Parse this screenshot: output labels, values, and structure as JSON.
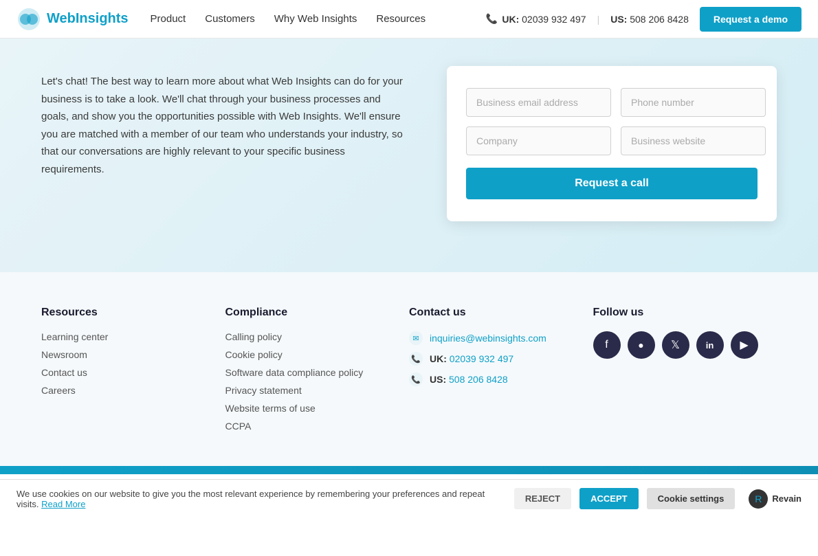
{
  "navbar": {
    "logo_text_main": "Web",
    "logo_text_highlight": "Insights",
    "links": [
      {
        "id": "product",
        "label": "Product"
      },
      {
        "id": "customers",
        "label": "Customers"
      },
      {
        "id": "why",
        "label": "Why Web Insights"
      },
      {
        "id": "resources",
        "label": "Resources"
      }
    ],
    "phone_uk_label": "UK:",
    "phone_uk": "02039 932 497",
    "phone_us_label": "US:",
    "phone_us": "508 206 8428",
    "cta_label": "Request a demo"
  },
  "hero": {
    "description": "Let's chat! The best way to learn more about what Web Insights can do for your business is to take a look. We'll chat through your business processes and goals, and show you the opportunities possible with Web Insights. We'll ensure you are matched with a member of our team who understands your industry, so that our conversations are highly relevant to your specific business requirements."
  },
  "form": {
    "fields": [
      {
        "id": "business-email",
        "placeholder": "Business email address"
      },
      {
        "id": "phone-number",
        "placeholder": "Phone number"
      },
      {
        "id": "company",
        "placeholder": "Company"
      },
      {
        "id": "website",
        "placeholder": "Business website"
      }
    ],
    "submit_label": "Request a call"
  },
  "footer": {
    "resources": {
      "title": "Resources",
      "links": [
        {
          "id": "learning-center",
          "label": "Learning center"
        },
        {
          "id": "newsroom",
          "label": "Newsroom"
        },
        {
          "id": "contact-us-link",
          "label": "Contact us"
        },
        {
          "id": "careers",
          "label": "Careers"
        }
      ]
    },
    "compliance": {
      "title": "Compliance",
      "links": [
        {
          "id": "calling-policy",
          "label": "Calling policy"
        },
        {
          "id": "cookie-policy",
          "label": "Cookie policy"
        },
        {
          "id": "software-data",
          "label": "Software data compliance policy"
        },
        {
          "id": "privacy-statement",
          "label": "Privacy statement"
        },
        {
          "id": "website-terms",
          "label": "Website terms of use"
        },
        {
          "id": "ccpa",
          "label": "CCPA"
        }
      ]
    },
    "contact": {
      "title": "Contact us",
      "email": "inquiries@webinsights.com",
      "phone_uk_label": "UK:",
      "phone_uk": "02039 932 497",
      "phone_us_label": "US:",
      "phone_us": "508 206 8428"
    },
    "follow": {
      "title": "Follow us",
      "social": [
        {
          "id": "facebook",
          "icon": "f"
        },
        {
          "id": "instagram",
          "icon": "📷"
        },
        {
          "id": "twitter",
          "icon": "𝕏"
        },
        {
          "id": "linkedin",
          "icon": "in"
        },
        {
          "id": "youtube",
          "icon": "▶"
        }
      ]
    }
  },
  "cookie_bar": {
    "text": "We use cookies on our website to give you the most relevant experience by remembering your preferences and repeat visits.",
    "read_more_label": "Read More",
    "reject_label": "REJECT",
    "accept_label": "ACCEPT",
    "settings_label": "Cookie settings",
    "revain_label": "Revain"
  }
}
